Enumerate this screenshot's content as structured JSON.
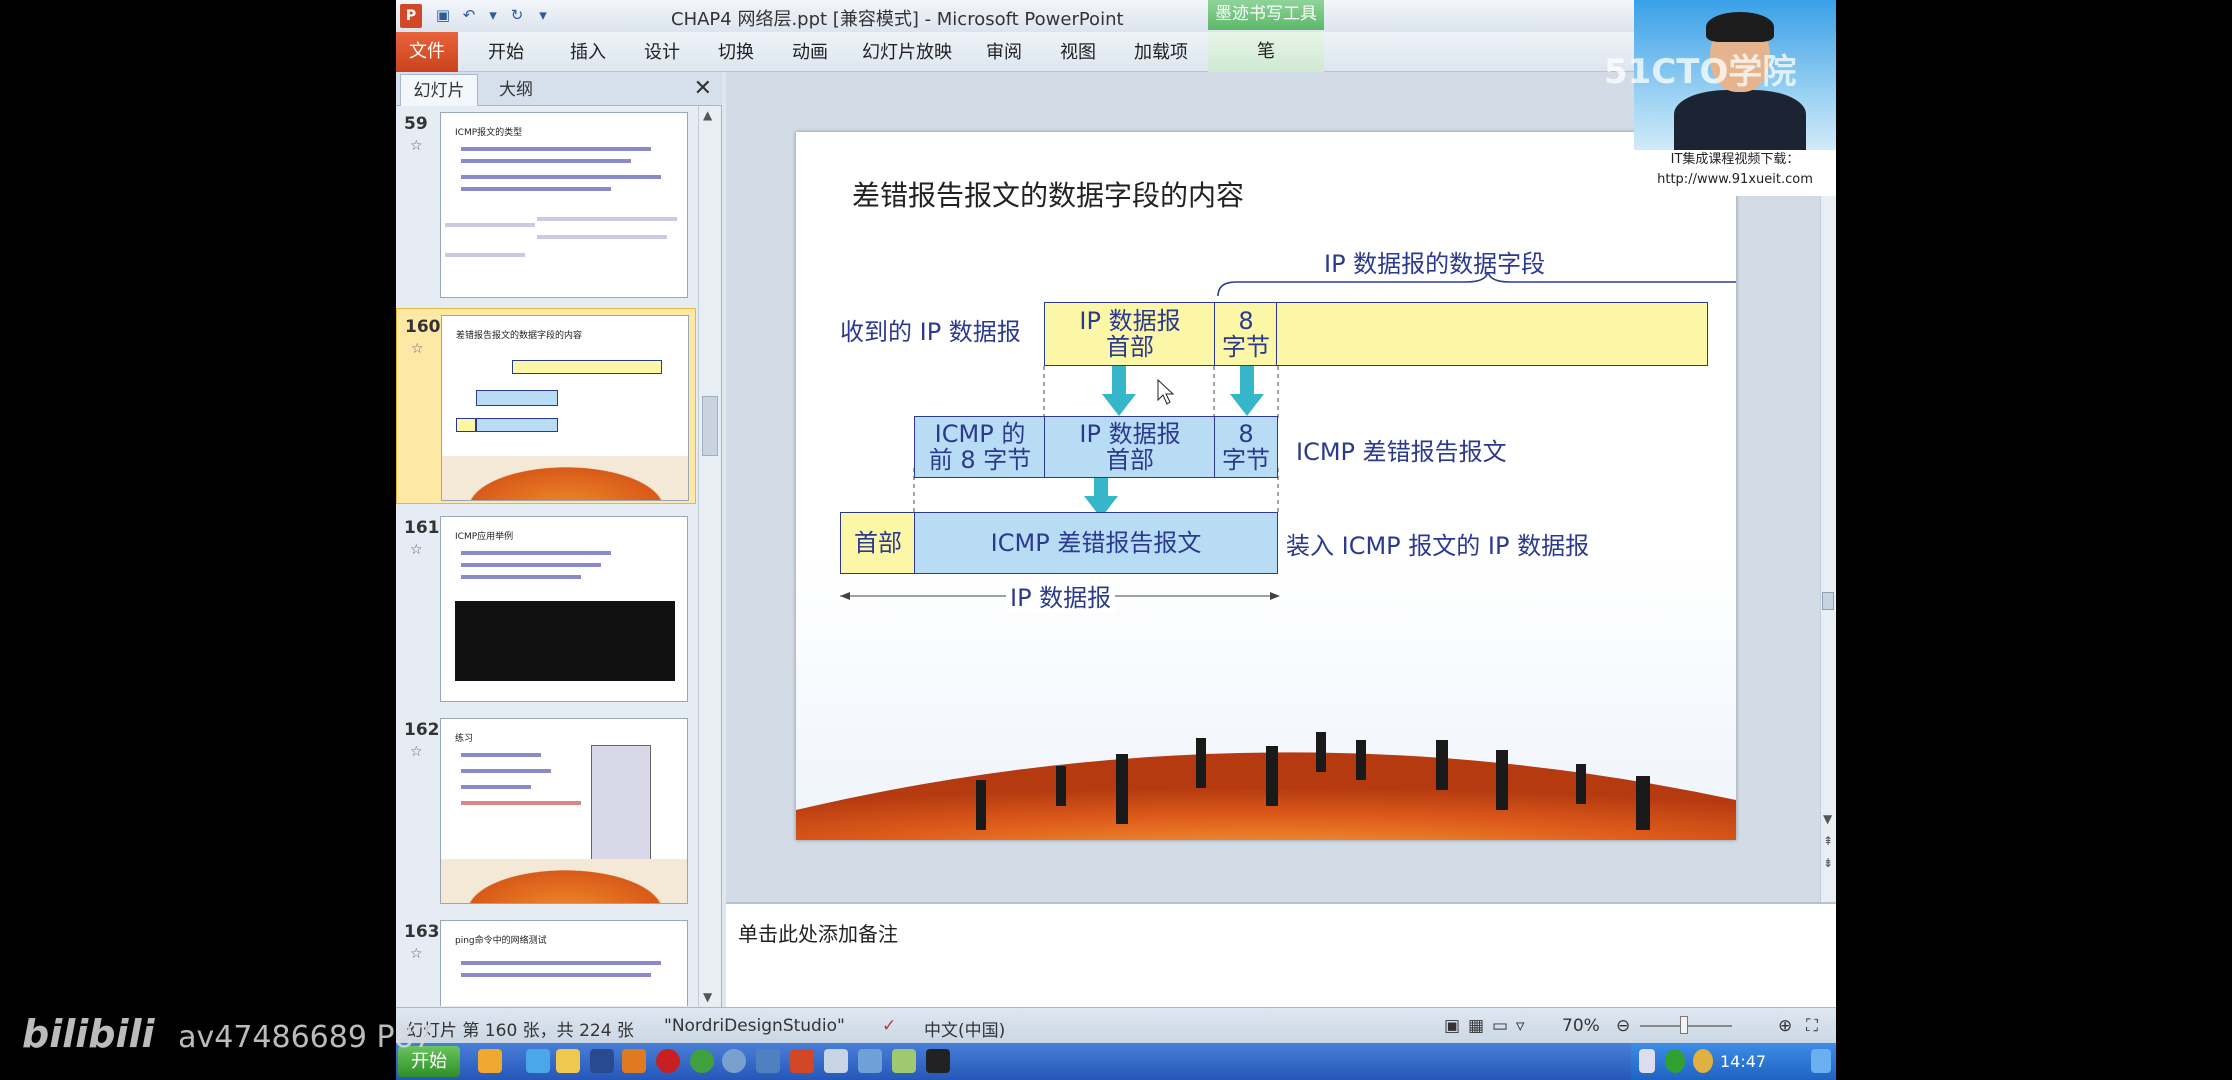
{
  "window": {
    "title": "CHAP4 网络层.ppt [兼容模式] - Microsoft PowerPoint",
    "contextual_tab_group": "墨迹书写工具"
  },
  "ribbon": {
    "tabs": [
      "文件",
      "开始",
      "插入",
      "设计",
      "切换",
      "动画",
      "幻灯片放映",
      "审阅",
      "视图",
      "加载项",
      "笔"
    ]
  },
  "panel": {
    "tabs": [
      "幻灯片",
      "大纲"
    ],
    "thumbnails": [
      {
        "number": "59",
        "title": "ICMP报文的类型"
      },
      {
        "number": "160",
        "title": "差错报告报文的数据字段的内容"
      },
      {
        "number": "161",
        "title": "ICMP应用举例"
      },
      {
        "number": "162",
        "title": "练习"
      },
      {
        "number": "163",
        "title": "ping命令中的网络测试"
      }
    ]
  },
  "slide": {
    "title": "差错报告报文的数据字段的内容",
    "ip_data_field_label": "IP 数据报的数据字段",
    "received_label": "收到的 IP 数据报",
    "row1_header": "IP 数据报\n首部",
    "row1_8bytes": "8\n字节",
    "row2_icmp8": "ICMP 的\n前 8 字节",
    "row2_header": "IP 数据报\n首部",
    "row2_8bytes": "8\n字节",
    "row2_label": "ICMP 差错报告报文",
    "row3_header": "首部",
    "row3_body": "ICMP 差错报告报文",
    "row3_label": "装入 ICMP 报文的 IP 数据报",
    "ip_datagram_label": "IP 数据报"
  },
  "notes": {
    "placeholder": "单击此处添加备注"
  },
  "status": {
    "slide_info": "幻灯片 第 160 张，共 224 张",
    "theme": "\"NordriDesignStudio\"",
    "language": "中文(中国)",
    "zoom": "70%"
  },
  "taskbar": {
    "start": "开始",
    "time": "14:47"
  },
  "webcam": {
    "brand": "51CTO学院",
    "caption_line1": "IT集成课程视频下载：",
    "caption_line2": "http://www.91xueit.com"
  },
  "watermark": {
    "logo": "bilibili",
    "id": "av47486689 P87"
  },
  "colors": {
    "file_tab": "#d24726",
    "slide_text": "#2b3a8f",
    "yellow_box": "#fbf7a6",
    "blue_box": "#b9dcf5",
    "arrow": "#36b6c9"
  }
}
